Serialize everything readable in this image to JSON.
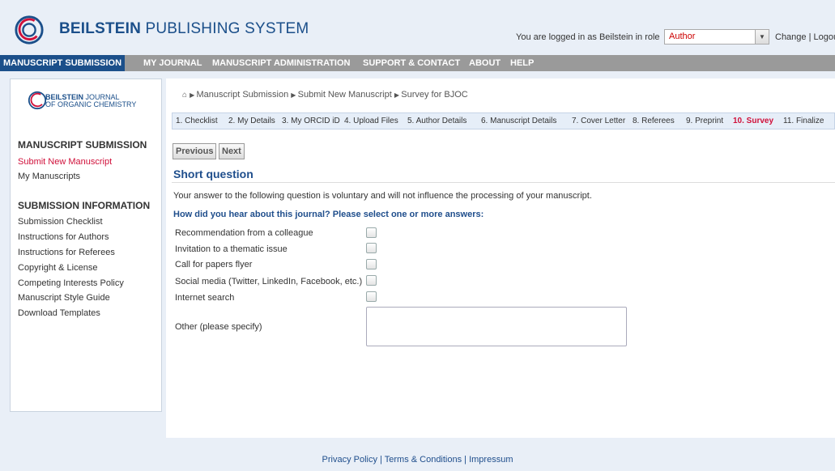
{
  "header": {
    "brand_bold": "BEILSTEIN",
    "brand_rest": " PUBLISHING SYSTEM",
    "login_text": "You are logged in as Beilstein in role",
    "role": "Author",
    "links": "Change | Logou"
  },
  "nav": {
    "items": [
      "MANUSCRIPT SUBMISSION",
      "MY JOURNAL",
      "MANUSCRIPT ADMINISTRATION",
      "SUPPORT & CONTACT",
      "ABOUT",
      "HELP"
    ]
  },
  "sidebar": {
    "journal_bold": "BEILSTEIN",
    "journal_rest": " JOURNAL",
    "journal_line2": "OF ORGANIC CHEMISTRY",
    "sections": [
      {
        "heading": "MANUSCRIPT SUBMISSION",
        "links": [
          "Submit New Manuscript",
          "My Manuscripts"
        ]
      },
      {
        "heading": "SUBMISSION INFORMATION",
        "links": [
          "Submission Checklist",
          "Instructions for Authors",
          "Instructions for Referees",
          "Copyright & License",
          "Competing Interests Policy",
          "Manuscript Style Guide",
          "Download Templates"
        ]
      }
    ]
  },
  "breadcrumb": {
    "home_icon": "home-icon",
    "items": [
      "Manuscript Submission",
      "Submit New Manuscript",
      "Survey for BJOC"
    ]
  },
  "steps": [
    "1. Checklist",
    "2. My Details",
    "3. My ORCID iD",
    "4. Upload Files",
    "5. Author Details",
    "6. Manuscript Details",
    "7. Cover Letter",
    "8. Referees",
    "9. Preprint",
    "10. Survey",
    "11. Finalize"
  ],
  "buttons": {
    "previous": "Previous",
    "next": "Next"
  },
  "form": {
    "title": "Short question",
    "intro": "Your answer to the following question is voluntary and will not influence the processing of your manuscript.",
    "question": "How did you hear about this journal? Please select one or more answers:",
    "options": [
      "Recommendation from a colleague",
      "Invitation to a thematic issue",
      "Call for papers flyer",
      "Social media (Twitter, LinkedIn, Facebook, etc.)",
      "Internet search"
    ],
    "other_label": "Other (please specify)",
    "other_value": ""
  },
  "footer": "Privacy Policy | Terms & Conditions | Impressum",
  "colors": {
    "brand_blue": "#1b4f8a",
    "active_red": "#d0103a",
    "nav_gray": "#9a9a9a",
    "page_bg": "#e9eff7"
  }
}
